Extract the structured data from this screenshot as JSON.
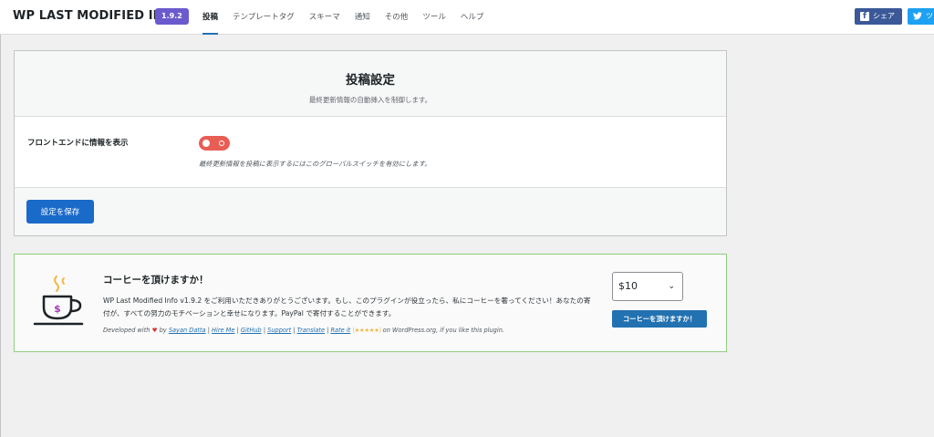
{
  "header": {
    "brand": "WP LAST MODIFIED INFO",
    "version": "1.9.2",
    "tabs": [
      {
        "label": "投稿",
        "active": true
      },
      {
        "label": "テンプレートタグ",
        "active": false
      },
      {
        "label": "スキーマ",
        "active": false
      },
      {
        "label": "通知",
        "active": false
      },
      {
        "label": "その他",
        "active": false
      },
      {
        "label": "ツール",
        "active": false
      },
      {
        "label": "ヘルプ",
        "active": false
      }
    ],
    "share_facebook": "シェア",
    "share_twitter": "ツ"
  },
  "settings": {
    "title": "投稿設定",
    "subtitle": "最終更新情報の自動挿入を制御します。",
    "field_label": "フロントエンドに情報を表示",
    "toggle_state": "off",
    "field_description": "最終更新情報を投稿に表示するにはこのグローバルスイッチを有効にします。",
    "save_label": "設定を保存"
  },
  "donation": {
    "title": "コーヒーを頂けますか！",
    "text": "WP Last Modified Info v1.9.2 をご利用いただきありがとうございます。もし、このプラグインが役立ったら、私にコーヒーを奢ってください！あなたの寄付が、すべての努力のモチベーションと幸せになります。PayPal で寄付することができます。",
    "credits": {
      "prefix": "Developed with",
      "heart": "♥",
      "by": "by",
      "author": "Sayan Datta",
      "hire": "Hire Me",
      "github": "GitHub",
      "support": "Support",
      "translate": "Translate",
      "rate": "Rate it",
      "stars": "(★★★★★)",
      "suffix": "on WordPress.org, if you like this plugin."
    },
    "amount": "$10",
    "button_label": "コーヒーを頂けますか！"
  },
  "colors": {
    "accent": "#2271b1",
    "toggle_off": "#e85d54",
    "badge": "#6a5acd",
    "donate_border": "#8fce7f"
  }
}
